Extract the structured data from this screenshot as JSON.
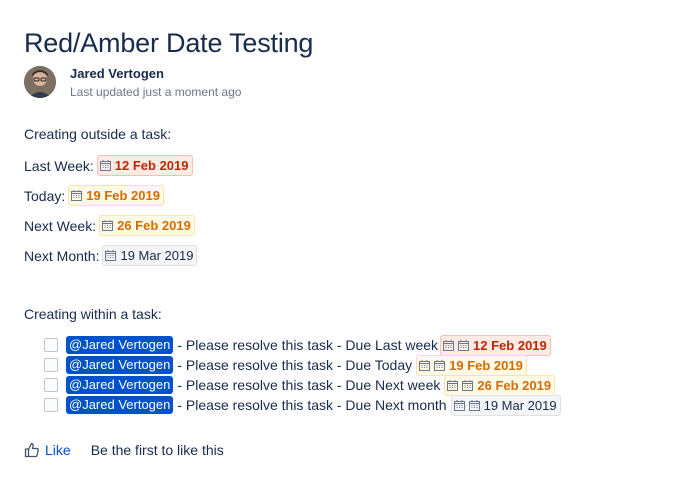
{
  "page": {
    "title": "Red/Amber Date Testing"
  },
  "byline": {
    "author": "Jared Vertogen",
    "updated": "Last updated just a moment ago"
  },
  "section_outside": {
    "heading": "Creating outside a task:",
    "rows": [
      {
        "label": "Last Week:",
        "date": "12 Feb 2019",
        "status": "red"
      },
      {
        "label": "Today:",
        "date": "19 Feb 2019",
        "status": "amber"
      },
      {
        "label": "Next Week:",
        "date": "26 Feb 2019",
        "status": "amber"
      },
      {
        "label": "Next Month:",
        "date": "19 Mar 2019",
        "status": "plain"
      }
    ]
  },
  "section_within": {
    "heading": "Creating within a task:",
    "tasks": [
      {
        "mention": "@Jared Vertogen",
        "text": "- Please resolve this task - Due Last week",
        "date": "12 Feb 2019",
        "status": "red"
      },
      {
        "mention": "@Jared Vertogen",
        "text": "- Please resolve this task - Due Today",
        "date": "19 Feb 2019",
        "status": "amber"
      },
      {
        "mention": "@Jared Vertogen",
        "text": "- Please resolve this task - Due Next week",
        "date": "26 Feb 2019",
        "status": "amber"
      },
      {
        "mention": "@Jared Vertogen",
        "text": "- Please resolve this task - Due Next month",
        "date": "19 Mar 2019",
        "status": "plain"
      }
    ]
  },
  "footer": {
    "like_label": "Like",
    "like_note": "Be the first to like this"
  },
  "colors": {
    "red": "#bf2600",
    "amber": "#d46b08",
    "mention_bg": "#0052cc",
    "link": "#0052cc"
  },
  "icons": {
    "date": "calendar-icon",
    "like": "thumbs-up-icon"
  }
}
